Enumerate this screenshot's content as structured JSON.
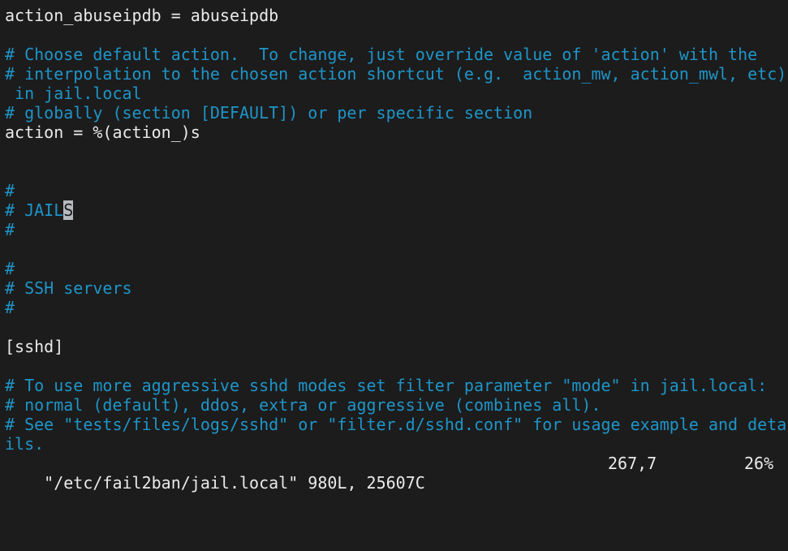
{
  "editor": {
    "lines": [
      {
        "type": "normal",
        "text": "action_abuseipdb = abuseipdb"
      },
      {
        "type": "normal",
        "text": ""
      },
      {
        "type": "comment",
        "text": "# Choose default action.  To change, just override value of 'action' with the"
      },
      {
        "type": "comment",
        "text": "# interpolation to the chosen action shortcut (e.g.  action_mw, action_mwl, etc)"
      },
      {
        "type": "comment",
        "text": " in jail.local"
      },
      {
        "type": "comment",
        "text": "# globally (section [DEFAULT]) or per specific section"
      },
      {
        "type": "normal",
        "text": "action = %(action_)s"
      },
      {
        "type": "normal",
        "text": ""
      },
      {
        "type": "normal",
        "text": ""
      },
      {
        "type": "comment",
        "text": "#"
      },
      {
        "type": "cursor_line",
        "before": "# JAIL",
        "cursor_char": "S",
        "after": ""
      },
      {
        "type": "comment",
        "text": "#"
      },
      {
        "type": "normal",
        "text": ""
      },
      {
        "type": "comment",
        "text": "#"
      },
      {
        "type": "comment",
        "text": "# SSH servers"
      },
      {
        "type": "comment",
        "text": "#"
      },
      {
        "type": "normal",
        "text": ""
      },
      {
        "type": "normal",
        "text": "[sshd]"
      },
      {
        "type": "normal",
        "text": ""
      },
      {
        "type": "comment",
        "text": "# To use more aggressive sshd modes set filter parameter \"mode\" in jail.local:"
      },
      {
        "type": "comment",
        "text": "# normal (default), ddos, extra or aggressive (combines all)."
      },
      {
        "type": "comment",
        "text": "# See \"tests/files/logs/sshd\" or \"filter.d/sshd.conf\" for usage example and deta"
      },
      {
        "type": "comment",
        "text": "ils."
      }
    ],
    "colors": {
      "background": "#1c1c1c",
      "text": "#eaeaea",
      "comment": "#1e95c8",
      "cursor": "#b8b8c0"
    }
  },
  "status_line": {
    "file_info": "\"/etc/fail2ban/jail.local\" 980L, 25607C",
    "cursor_position": "267,7",
    "scroll_percent": "26%"
  }
}
